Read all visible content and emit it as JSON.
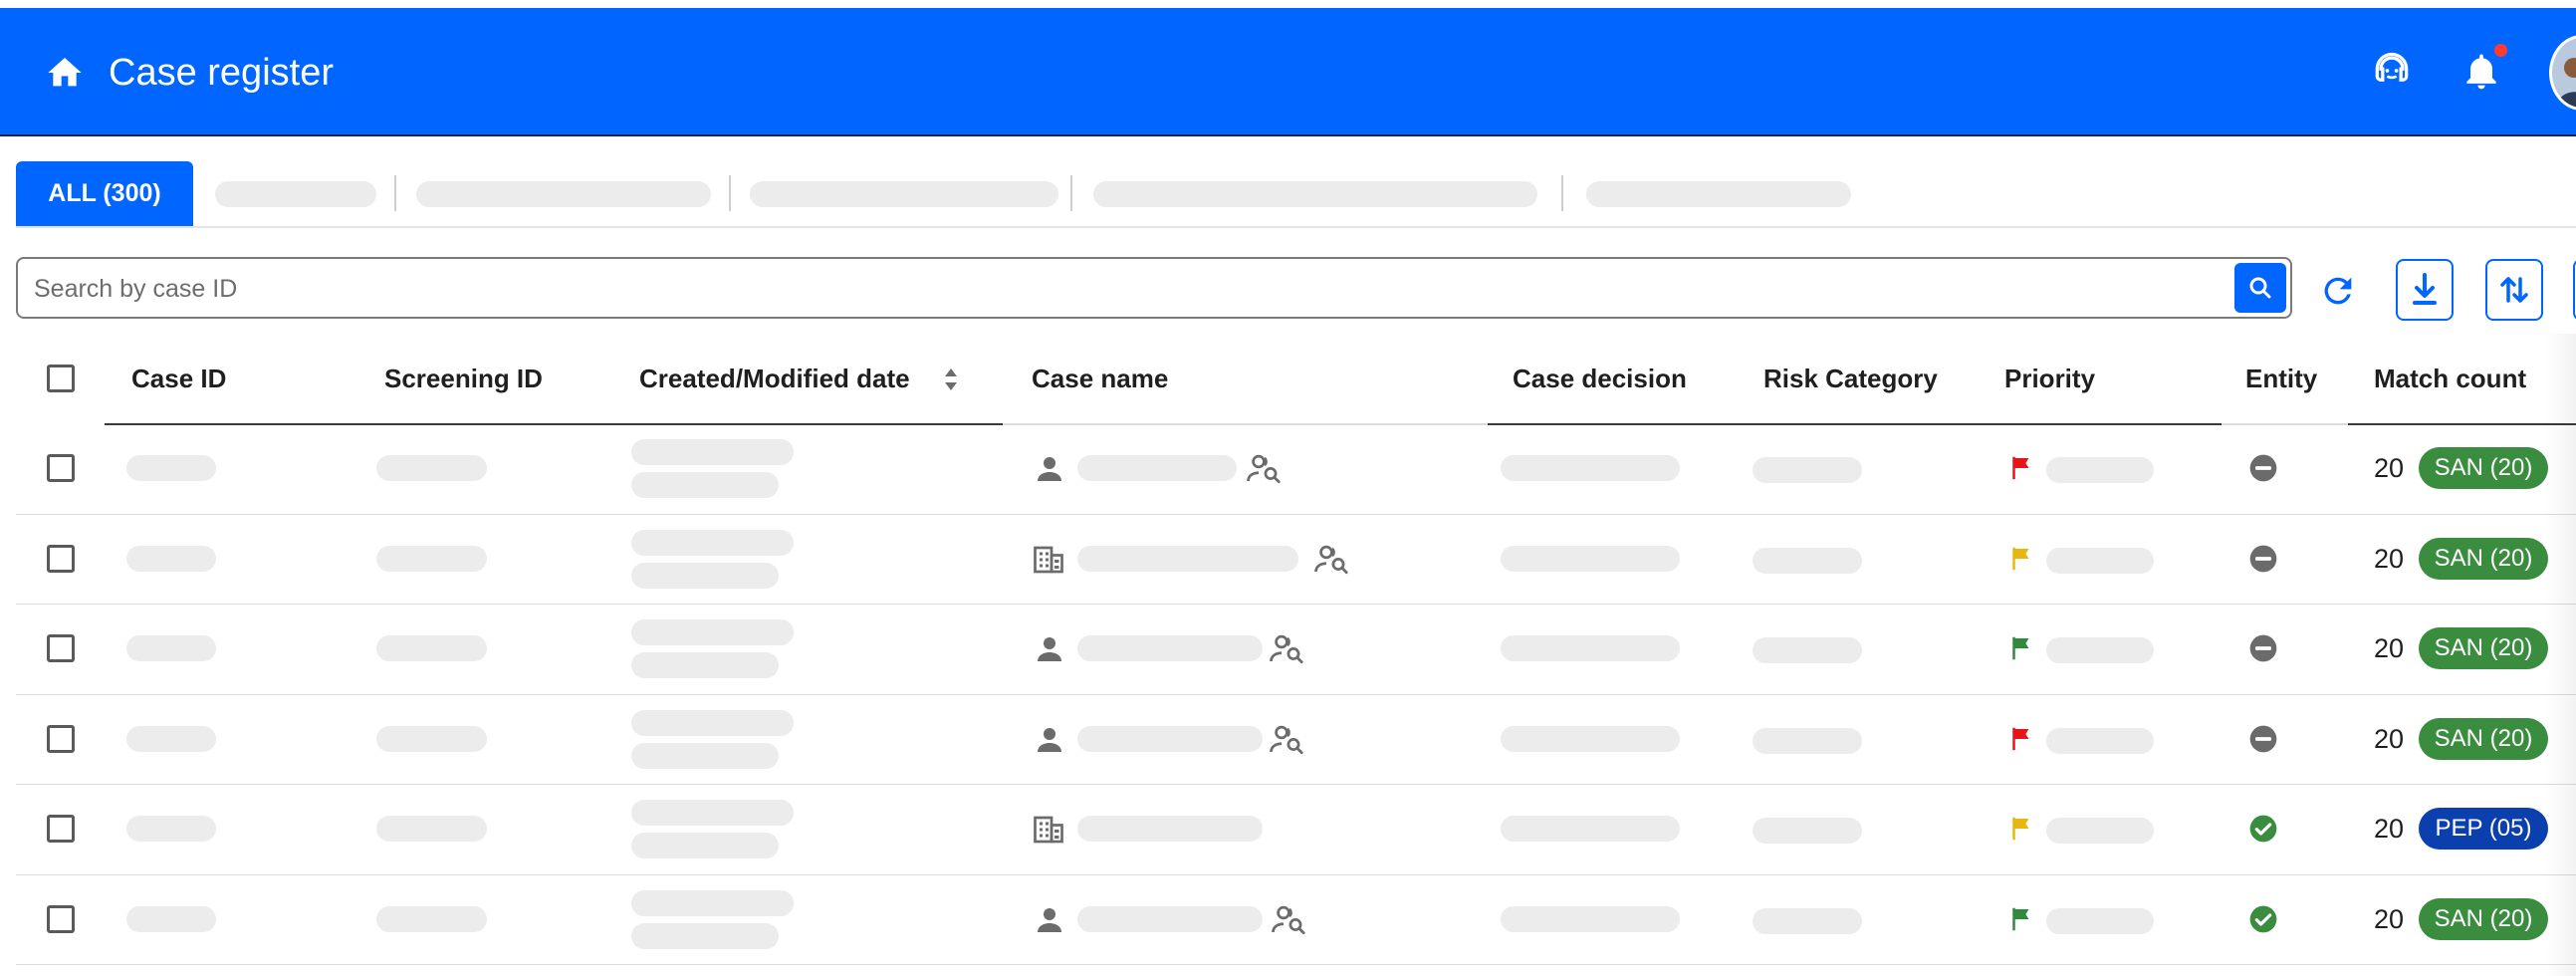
{
  "header": {
    "title": "Case register",
    "colors": {
      "bar": "#0066ff",
      "notification_dot": "#ff3b30"
    },
    "icons": [
      "home-icon",
      "support-agent-icon",
      "bell-icon",
      "avatar"
    ]
  },
  "tabs": [
    {
      "label": "ALL (300)",
      "active": true
    }
  ],
  "search": {
    "placeholder": "Search by case ID"
  },
  "toolbar": {
    "icons": [
      "refresh-icon",
      "download-icon",
      "sort-icon"
    ]
  },
  "table": {
    "columns": [
      "Case ID",
      "Screening ID",
      "Created/Modified date",
      "Case name",
      "Case decision",
      "Risk Category",
      "Priority",
      "Entity",
      "Match count"
    ],
    "rows": [
      {
        "name_type": "person-icon",
        "has_search": true,
        "priority_color": "#e8141b",
        "entity": "blocked-icon",
        "count": "20",
        "chip": "SAN (20)",
        "chip_color": "#3a8c3f"
      },
      {
        "name_type": "building-icon",
        "has_search": true,
        "priority_color": "#e8b70f",
        "entity": "blocked-icon",
        "count": "20",
        "chip": "SAN (20)",
        "chip_color": "#3a8c3f"
      },
      {
        "name_type": "person-icon",
        "has_search": true,
        "priority_color": "#2e8b3d",
        "entity": "blocked-icon",
        "count": "20",
        "chip": "SAN (20)",
        "chip_color": "#3a8c3f"
      },
      {
        "name_type": "person-icon",
        "has_search": true,
        "priority_color": "#e8141b",
        "entity": "blocked-icon",
        "count": "20",
        "chip": "SAN (20)",
        "chip_color": "#3a8c3f"
      },
      {
        "name_type": "building-icon",
        "has_search": false,
        "priority_color": "#e8b70f",
        "entity": "check-circle-icon",
        "count": "20",
        "chip": "PEP (05)",
        "chip_color": "#0b3fae"
      },
      {
        "name_type": "person-icon",
        "has_search": true,
        "priority_color": "#2e8b3d",
        "entity": "check-circle-icon",
        "count": "20",
        "chip": "SAN (20)",
        "chip_color": "#3a8c3f"
      }
    ]
  }
}
